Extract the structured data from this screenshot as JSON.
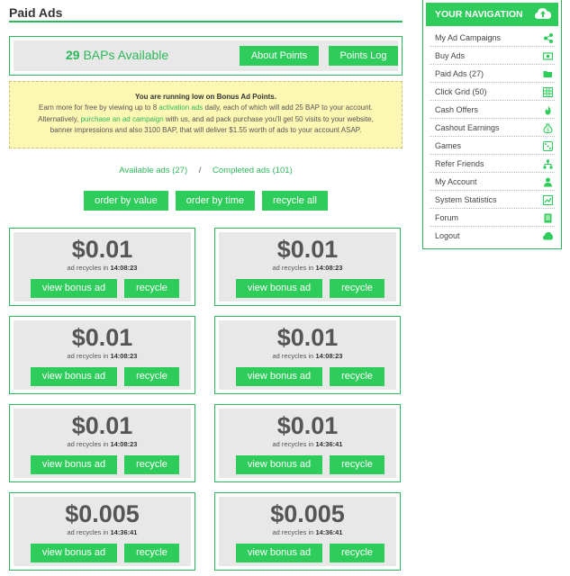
{
  "page_title": "Paid Ads",
  "bap": {
    "count": "29",
    "label": "BAPs Available",
    "about_label": "About Points",
    "log_label": "Points Log"
  },
  "warning": {
    "heading": "You are running low on Bonus Ad Points.",
    "line1_a": "Earn more for free by viewing up to 8 ",
    "line1_link": "activation ads",
    "line1_b": " daily, each of which will add 25 BAP to your account.",
    "line2_a": "Alternatively, ",
    "line2_link": "purchase an ad campaign",
    "line2_b": " with us, and ad pack purchase you'll get 50 visits to your website,",
    "line3": "banner impressions and also 3100 BAP, that will deliver $1.55 worth of ads to your account ASAP."
  },
  "ad_links": {
    "available": "Available ads (27)",
    "separator": "/",
    "completed": "Completed ads (101)"
  },
  "order_buttons": {
    "by_value": "order by value",
    "by_time": "order by time",
    "recycle_all": "recycle all"
  },
  "ads": [
    {
      "price": "$0.01",
      "timer_prefix": "ad recycles in",
      "timer": "14:08:23",
      "view_label": "view bonus ad",
      "recycle_label": "recycle"
    },
    {
      "price": "$0.01",
      "timer_prefix": "ad recycles in",
      "timer": "14:08:23",
      "view_label": "view bonus ad",
      "recycle_label": "recycle"
    },
    {
      "price": "$0.01",
      "timer_prefix": "ad recycles in",
      "timer": "14:08:23",
      "view_label": "view bonus ad",
      "recycle_label": "recycle"
    },
    {
      "price": "$0.01",
      "timer_prefix": "ad recycles in",
      "timer": "14:08:23",
      "view_label": "view bonus ad",
      "recycle_label": "recycle"
    },
    {
      "price": "$0.01",
      "timer_prefix": "ad recycles in",
      "timer": "14:08:23",
      "view_label": "view bonus ad",
      "recycle_label": "recycle"
    },
    {
      "price": "$0.01",
      "timer_prefix": "ad recycles in",
      "timer": "14:36:41",
      "view_label": "view bonus ad",
      "recycle_label": "recycle"
    },
    {
      "price": "$0.005",
      "timer_prefix": "ad recycles in",
      "timer": "14:36:41",
      "view_label": "view bonus ad",
      "recycle_label": "recycle"
    },
    {
      "price": "$0.005",
      "timer_prefix": "ad recycles in",
      "timer": "14:36:41",
      "view_label": "view bonus ad",
      "recycle_label": "recycle"
    }
  ],
  "nav": {
    "title": "YOUR NAVIGATION",
    "items": [
      {
        "label": "My Ad Campaigns",
        "icon": "share-icon"
      },
      {
        "label": "Buy Ads",
        "icon": "money-icon"
      },
      {
        "label": "Paid Ads (27)",
        "icon": "folder-open-icon"
      },
      {
        "label": "Click Grid (50)",
        "icon": "grid-icon"
      },
      {
        "label": "Cash Offers",
        "icon": "fire-icon"
      },
      {
        "label": "Cashout Earnings",
        "icon": "money-bag-icon"
      },
      {
        "label": "Games",
        "icon": "dice-icon"
      },
      {
        "label": "Refer Friends",
        "icon": "sitemap-icon"
      },
      {
        "label": "My Account",
        "icon": "user-icon"
      },
      {
        "label": "System Statistics",
        "icon": "chart-icon"
      },
      {
        "label": "Forum",
        "icon": "book-icon"
      },
      {
        "label": "Logout",
        "icon": "cloud-icon"
      }
    ]
  },
  "colors": {
    "accent": "#2ecc5a",
    "accent_text": "#2eb85c",
    "warning_bg": "#fdf7b4",
    "card_bg": "#e8e8e8"
  }
}
